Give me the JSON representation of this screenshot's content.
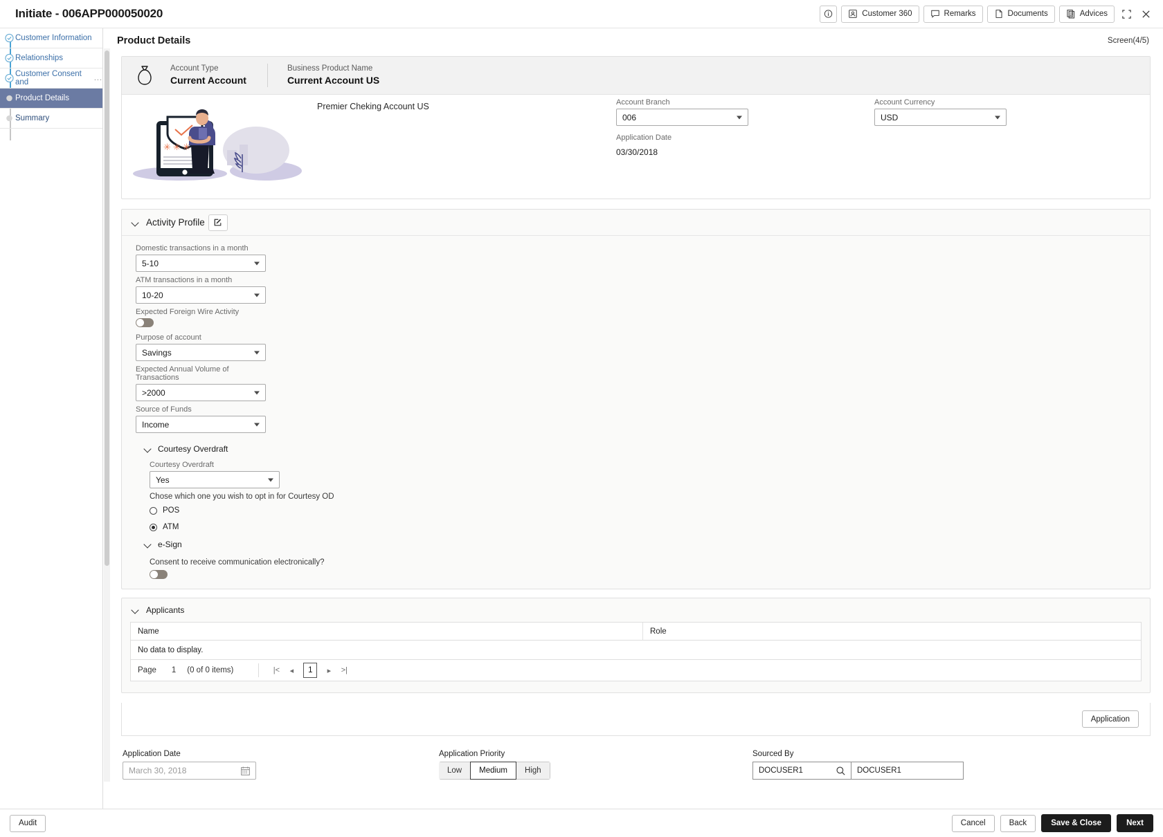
{
  "topbar": {
    "title": "Initiate - 006APP000050020",
    "buttons": [
      {
        "name": "info-icon-button",
        "label": "",
        "icon": "info-icon"
      },
      {
        "name": "customer-360-button",
        "label": "Customer 360",
        "icon": "user-card-icon"
      },
      {
        "name": "remarks-button",
        "label": "Remarks",
        "icon": "comment-icon"
      },
      {
        "name": "documents-button",
        "label": "Documents",
        "icon": "document-icon"
      },
      {
        "name": "advices-button",
        "label": "Advices",
        "icon": "advices-icon"
      }
    ],
    "minimize_label": "minimize-icon",
    "close_label": "close-icon"
  },
  "sidebar": {
    "items": [
      {
        "label": "Customer Information",
        "state": "done",
        "truncated": false
      },
      {
        "label": "Relationships",
        "state": "done",
        "truncated": false
      },
      {
        "label": "Customer Consent and",
        "state": "done",
        "truncated": true,
        "ellipsis": "..."
      },
      {
        "label": "Product Details",
        "state": "active",
        "truncated": false
      },
      {
        "label": "Summary",
        "state": "pending",
        "truncated": false
      }
    ]
  },
  "main": {
    "page_title": "Product Details",
    "screen_count": "Screen(4/5)",
    "product_strip": {
      "account_type_label": "Account Type",
      "account_type_value": "Current Account",
      "business_product_label": "Business Product Name",
      "business_product_value": "Current Account US"
    },
    "product_name": "Premier Cheking Account US",
    "account_branch": {
      "label": "Account Branch",
      "value": "006"
    },
    "account_currency": {
      "label": "Account Currency",
      "value": "USD"
    },
    "application_date": {
      "label": "Application Date",
      "value": "03/30/2018"
    }
  },
  "activity_profile": {
    "title": "Activity Profile",
    "edit_icon": "edit-icon",
    "fields": [
      {
        "label": "Domestic transactions in a month",
        "value": "5-10",
        "type": "select"
      },
      {
        "label": "ATM transactions in a month",
        "value": "10-20",
        "type": "select"
      },
      {
        "label": "Expected Foreign Wire Activity",
        "value": "",
        "type": "toggle",
        "on": false
      },
      {
        "label": "Purpose of account",
        "value": "Savings",
        "type": "select"
      },
      {
        "label": "Expected Annual Volume of Transactions",
        "value": ">2000",
        "type": "select"
      },
      {
        "label": "Source of Funds",
        "value": "Income",
        "type": "select"
      }
    ],
    "courtesy_overdraft": {
      "title": "Courtesy Overdraft",
      "field_label": "Courtesy Overdraft",
      "field_value": "Yes",
      "helper": "Chose which one you wish to opt in for Courtesy OD",
      "options": [
        {
          "label": "POS",
          "selected": false
        },
        {
          "label": "ATM",
          "selected": true
        }
      ]
    },
    "esign": {
      "title": "e-Sign",
      "consent_label": "Consent to receive communication electronically?",
      "consent_on": false
    }
  },
  "applicants": {
    "title": "Applicants",
    "columns": [
      "Name",
      "Role"
    ],
    "rows": [],
    "empty_text": "No data to display.",
    "pager": {
      "page_label": "Page",
      "page_number": "1",
      "items_text": "(0 of 0 items)",
      "first": "|<",
      "prev": "◂",
      "current": "1",
      "next": "▸",
      "last": ">|"
    },
    "action_button": "Application"
  },
  "bottom_form": {
    "application_date": {
      "label": "Application Date",
      "placeholder": "March 30, 2018",
      "value": "",
      "icon": "calendar-icon"
    },
    "application_priority": {
      "label": "Application Priority",
      "options": [
        "Low",
        "Medium",
        "High"
      ],
      "selected": "Medium"
    },
    "sourced_by": {
      "label": "Sourced By",
      "code_value": "DOCUSER1",
      "name_value": "DOCUSER1",
      "icon": "search-icon"
    }
  },
  "footer": {
    "audit_label": "Audit",
    "cancel_label": "Cancel",
    "back_label": "Back",
    "save_close_label": "Save & Close",
    "next_label": "Next"
  },
  "colors": {
    "active_nav": "#6b7ba3",
    "nav_link": "#3b6fa8",
    "dark_button": "#1c1c1c",
    "strip_bg": "#f2f2f2"
  }
}
